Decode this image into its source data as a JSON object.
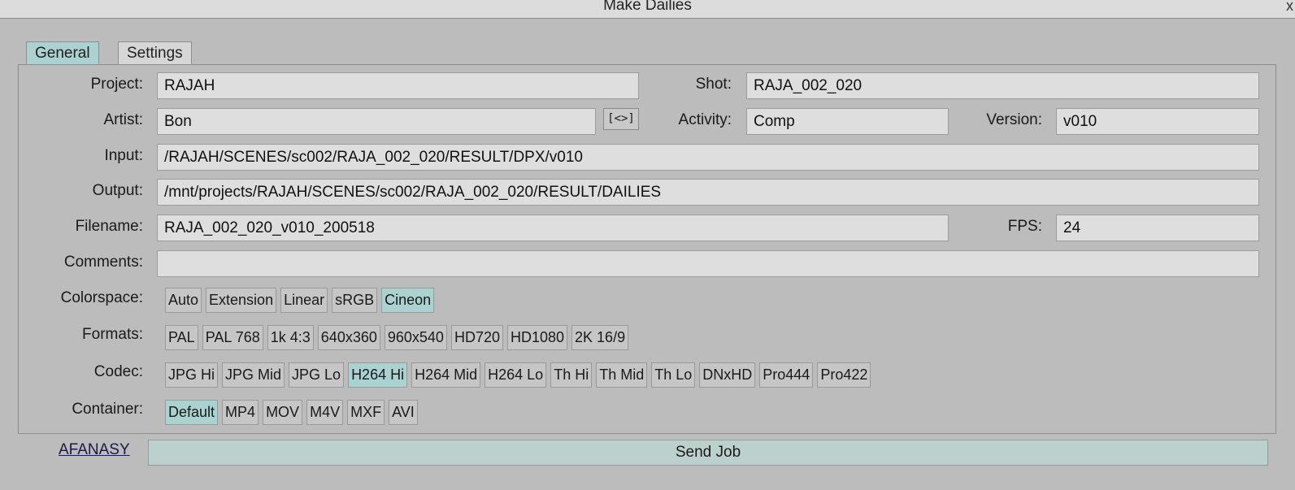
{
  "window": {
    "title": "Make Dailies",
    "close_label": "x"
  },
  "tabs": [
    {
      "label": "General"
    },
    {
      "label": "Settings"
    }
  ],
  "fields": {
    "project": {
      "label": "Project:",
      "value": "RAJAH"
    },
    "shot": {
      "label": "Shot:",
      "value": "RAJA_002_020"
    },
    "artist": {
      "label": "Artist:",
      "value": "Bon"
    },
    "swap_label": "[<>]",
    "activity": {
      "label": "Activity:",
      "value": "Comp"
    },
    "version": {
      "label": "Version:",
      "value": "v010"
    },
    "input": {
      "label": "Input:",
      "value": "/RAJAH/SCENES/sc002/RAJA_002_020/RESULT/DPX/v010"
    },
    "output": {
      "label": "Output:",
      "value": "/mnt/projects/RAJAH/SCENES/sc002/RAJA_002_020/RESULT/DAILIES"
    },
    "filename": {
      "label": "Filename:",
      "value": "RAJA_002_020_v010_200518"
    },
    "fps": {
      "label": "FPS:",
      "value": "24"
    },
    "comments": {
      "label": "Comments:",
      "value": ""
    }
  },
  "colorspace": {
    "label": "Colorspace:",
    "options": [
      "Auto",
      "Extension",
      "Linear",
      "sRGB",
      "Cineon"
    ],
    "selected": "Cineon"
  },
  "formats": {
    "label": "Formats:",
    "options": [
      "PAL",
      "PAL 768",
      "1k 4:3",
      "640x360",
      "960x540",
      "HD720",
      "HD1080",
      "2K 16/9"
    ],
    "selected": ""
  },
  "codec": {
    "label": "Codec:",
    "options": [
      "JPG Hi",
      "JPG Mid",
      "JPG Lo",
      "H264 Hi",
      "H264 Mid",
      "H264 Lo",
      "Th Hi",
      "Th Mid",
      "Th Lo",
      "DNxHD",
      "Pro444",
      "Pro422"
    ],
    "selected": "H264 Hi"
  },
  "container": {
    "label": "Container:",
    "options": [
      "Default",
      "MP4",
      "MOV",
      "M4V",
      "MXF",
      "AVI"
    ],
    "selected": "Default"
  },
  "footer": {
    "afanasy_label": "AFANASY",
    "send_label": "Send Job"
  },
  "colors": {
    "selected": "#a9d2d0",
    "send_button": "#bcd1ce"
  }
}
